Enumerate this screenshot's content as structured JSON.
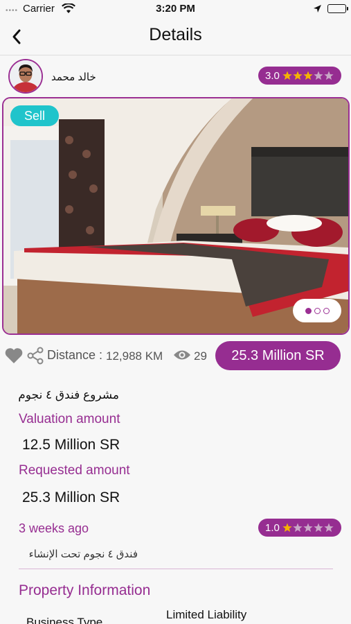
{
  "status_bar": {
    "carrier": "Carrier",
    "time": "3:20 PM"
  },
  "nav": {
    "title": "Details"
  },
  "owner": {
    "name": "خالد محمد",
    "rating": "3.0",
    "stars_filled": 3,
    "stars_total": 5
  },
  "listing": {
    "badge": "Sell",
    "carousel_pages": 3,
    "carousel_active": 0,
    "distance_label": "Distance :",
    "distance_value": "12,988 KM",
    "views": "29",
    "price": "25.3 Million SR",
    "title": "مشروع فندق ٤ نجوم",
    "valuation_label": "Valuation amount",
    "valuation_value": "12.5 Million SR",
    "requested_label": "Requested amount",
    "requested_value": "25.3 Million SR",
    "posted": "3 weeks ago",
    "rating": "1.0",
    "stars_filled": 1,
    "description": "فندق ٤ نجوم تحت الإنشاء"
  },
  "property_info": {
    "title": "Property Information",
    "rows": [
      {
        "label": "Business Type",
        "value": "Limited Liability"
      }
    ]
  },
  "colors": {
    "accent": "#962d91",
    "badge": "#20c4cb",
    "star": "#f5b301"
  }
}
